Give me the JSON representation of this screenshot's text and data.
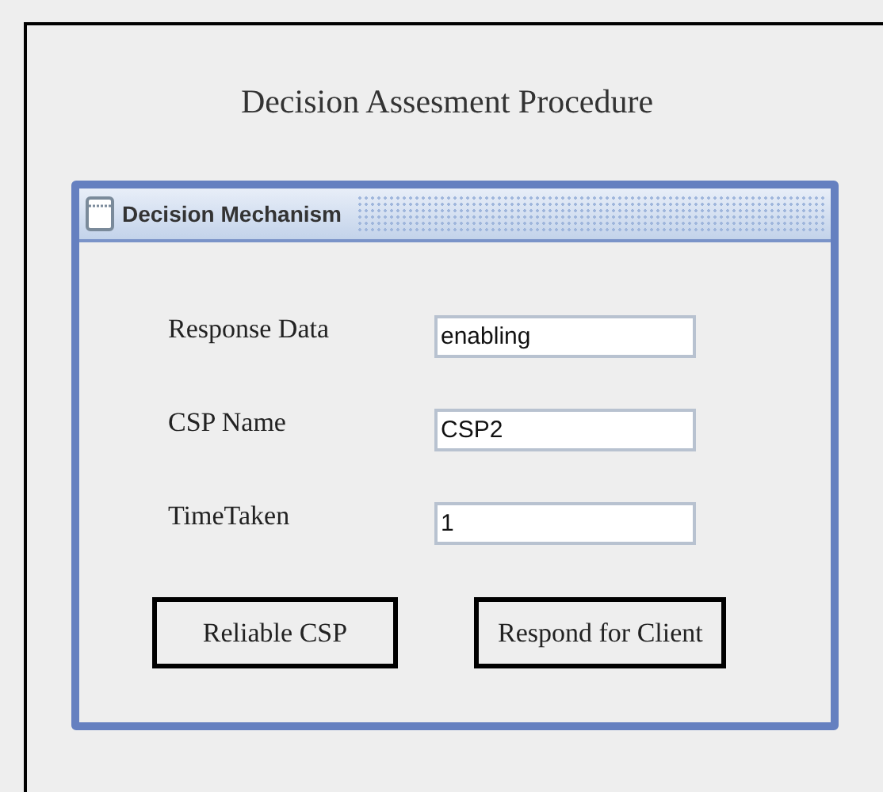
{
  "title": "Decision Assesment Procedure",
  "frame": {
    "title": "Decision Mechanism",
    "fields": [
      {
        "label": "Response Data",
        "value": "enabling"
      },
      {
        "label": "CSP Name",
        "value": "CSP2"
      },
      {
        "label": "TimeTaken",
        "value": "1"
      }
    ],
    "buttons": [
      "Reliable CSP",
      "Respond for Client"
    ]
  }
}
